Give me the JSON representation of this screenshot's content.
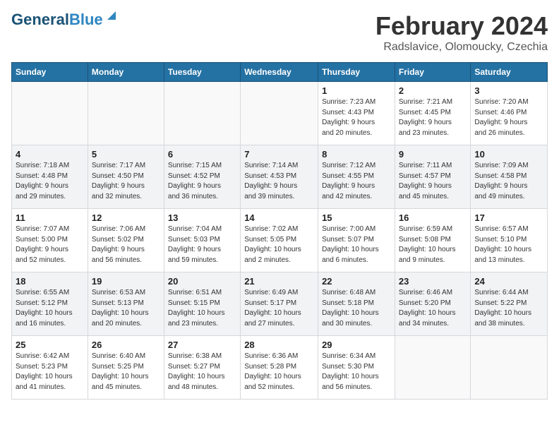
{
  "header": {
    "logo_line1": "General",
    "logo_line2": "Blue",
    "month_year": "February 2024",
    "location": "Radslavice, Olomoucky, Czechia"
  },
  "weekdays": [
    "Sunday",
    "Monday",
    "Tuesday",
    "Wednesday",
    "Thursday",
    "Friday",
    "Saturday"
  ],
  "weeks": [
    [
      {
        "day": "",
        "info": ""
      },
      {
        "day": "",
        "info": ""
      },
      {
        "day": "",
        "info": ""
      },
      {
        "day": "",
        "info": ""
      },
      {
        "day": "1",
        "info": "Sunrise: 7:23 AM\nSunset: 4:43 PM\nDaylight: 9 hours\nand 20 minutes."
      },
      {
        "day": "2",
        "info": "Sunrise: 7:21 AM\nSunset: 4:45 PM\nDaylight: 9 hours\nand 23 minutes."
      },
      {
        "day": "3",
        "info": "Sunrise: 7:20 AM\nSunset: 4:46 PM\nDaylight: 9 hours\nand 26 minutes."
      }
    ],
    [
      {
        "day": "4",
        "info": "Sunrise: 7:18 AM\nSunset: 4:48 PM\nDaylight: 9 hours\nand 29 minutes."
      },
      {
        "day": "5",
        "info": "Sunrise: 7:17 AM\nSunset: 4:50 PM\nDaylight: 9 hours\nand 32 minutes."
      },
      {
        "day": "6",
        "info": "Sunrise: 7:15 AM\nSunset: 4:52 PM\nDaylight: 9 hours\nand 36 minutes."
      },
      {
        "day": "7",
        "info": "Sunrise: 7:14 AM\nSunset: 4:53 PM\nDaylight: 9 hours\nand 39 minutes."
      },
      {
        "day": "8",
        "info": "Sunrise: 7:12 AM\nSunset: 4:55 PM\nDaylight: 9 hours\nand 42 minutes."
      },
      {
        "day": "9",
        "info": "Sunrise: 7:11 AM\nSunset: 4:57 PM\nDaylight: 9 hours\nand 45 minutes."
      },
      {
        "day": "10",
        "info": "Sunrise: 7:09 AM\nSunset: 4:58 PM\nDaylight: 9 hours\nand 49 minutes."
      }
    ],
    [
      {
        "day": "11",
        "info": "Sunrise: 7:07 AM\nSunset: 5:00 PM\nDaylight: 9 hours\nand 52 minutes."
      },
      {
        "day": "12",
        "info": "Sunrise: 7:06 AM\nSunset: 5:02 PM\nDaylight: 9 hours\nand 56 minutes."
      },
      {
        "day": "13",
        "info": "Sunrise: 7:04 AM\nSunset: 5:03 PM\nDaylight: 9 hours\nand 59 minutes."
      },
      {
        "day": "14",
        "info": "Sunrise: 7:02 AM\nSunset: 5:05 PM\nDaylight: 10 hours\nand 2 minutes."
      },
      {
        "day": "15",
        "info": "Sunrise: 7:00 AM\nSunset: 5:07 PM\nDaylight: 10 hours\nand 6 minutes."
      },
      {
        "day": "16",
        "info": "Sunrise: 6:59 AM\nSunset: 5:08 PM\nDaylight: 10 hours\nand 9 minutes."
      },
      {
        "day": "17",
        "info": "Sunrise: 6:57 AM\nSunset: 5:10 PM\nDaylight: 10 hours\nand 13 minutes."
      }
    ],
    [
      {
        "day": "18",
        "info": "Sunrise: 6:55 AM\nSunset: 5:12 PM\nDaylight: 10 hours\nand 16 minutes."
      },
      {
        "day": "19",
        "info": "Sunrise: 6:53 AM\nSunset: 5:13 PM\nDaylight: 10 hours\nand 20 minutes."
      },
      {
        "day": "20",
        "info": "Sunrise: 6:51 AM\nSunset: 5:15 PM\nDaylight: 10 hours\nand 23 minutes."
      },
      {
        "day": "21",
        "info": "Sunrise: 6:49 AM\nSunset: 5:17 PM\nDaylight: 10 hours\nand 27 minutes."
      },
      {
        "day": "22",
        "info": "Sunrise: 6:48 AM\nSunset: 5:18 PM\nDaylight: 10 hours\nand 30 minutes."
      },
      {
        "day": "23",
        "info": "Sunrise: 6:46 AM\nSunset: 5:20 PM\nDaylight: 10 hours\nand 34 minutes."
      },
      {
        "day": "24",
        "info": "Sunrise: 6:44 AM\nSunset: 5:22 PM\nDaylight: 10 hours\nand 38 minutes."
      }
    ],
    [
      {
        "day": "25",
        "info": "Sunrise: 6:42 AM\nSunset: 5:23 PM\nDaylight: 10 hours\nand 41 minutes."
      },
      {
        "day": "26",
        "info": "Sunrise: 6:40 AM\nSunset: 5:25 PM\nDaylight: 10 hours\nand 45 minutes."
      },
      {
        "day": "27",
        "info": "Sunrise: 6:38 AM\nSunset: 5:27 PM\nDaylight: 10 hours\nand 48 minutes."
      },
      {
        "day": "28",
        "info": "Sunrise: 6:36 AM\nSunset: 5:28 PM\nDaylight: 10 hours\nand 52 minutes."
      },
      {
        "day": "29",
        "info": "Sunrise: 6:34 AM\nSunset: 5:30 PM\nDaylight: 10 hours\nand 56 minutes."
      },
      {
        "day": "",
        "info": ""
      },
      {
        "day": "",
        "info": ""
      }
    ]
  ]
}
